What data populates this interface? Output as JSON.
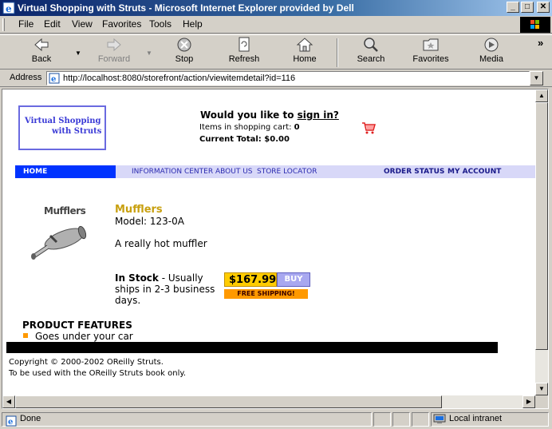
{
  "window": {
    "title": "Virtual Shopping with Struts - Microsoft Internet Explorer provided by Dell",
    "minimize_label": "_",
    "maximize_label": "□",
    "close_label": "✕"
  },
  "menu": [
    "File",
    "Edit",
    "View",
    "Favorites",
    "Tools",
    "Help"
  ],
  "toolbar": {
    "back": "Back",
    "forward": "Forward",
    "stop": "Stop",
    "refresh": "Refresh",
    "home": "Home",
    "search": "Search",
    "favorites": "Favorites",
    "media": "Media",
    "more": "»"
  },
  "address": {
    "label": "Address",
    "url": "http://localhost:8080/storefront/action/viewitemdetail?id=116"
  },
  "site": {
    "logo_line1": "Virtual Shopping",
    "logo_line2": "with Struts",
    "signin_prompt": "Would you like to",
    "signin_link": "sign in?",
    "cart_items_label": "Items in shopping cart:",
    "cart_items_count": "0",
    "cart_total_label": "Current Total:",
    "cart_total_value": "$0.00",
    "nav": {
      "home": "HOME",
      "info_center": "INFORMATION CENTER",
      "about_us": "ABOUT US",
      "store_locator": "STORE LOCATOR",
      "order_status": "ORDER STATUS",
      "my_account": "MY ACCOUNT"
    }
  },
  "product": {
    "image_caption": "Mufflers",
    "name": "Mufflers",
    "model": "Model: 123-0A",
    "description": "A really hot muffler",
    "stock_label": "In Stock",
    "stock_detail": " - Usually ships in 2-3 business days.",
    "price": "$167.99",
    "buy_label": "BUY",
    "shipping_badge": "FREE SHIPPING!",
    "features_heading": "PRODUCT FEATURES",
    "features": [
      "Goes under your car"
    ]
  },
  "footer": {
    "line1": "Copyright © 2000-2002 OReilly Struts.",
    "line2": "To be used with the OReilly Struts book only."
  },
  "status": {
    "text": "Done",
    "zone": "Local intranet"
  },
  "colors": {
    "nav_home_bg": "#0033ff",
    "nav_bar_bg": "#d8d8f8",
    "product_name": "#c8a010",
    "price_bg": "#ffcc00",
    "shipping_bg": "#ff9900"
  }
}
